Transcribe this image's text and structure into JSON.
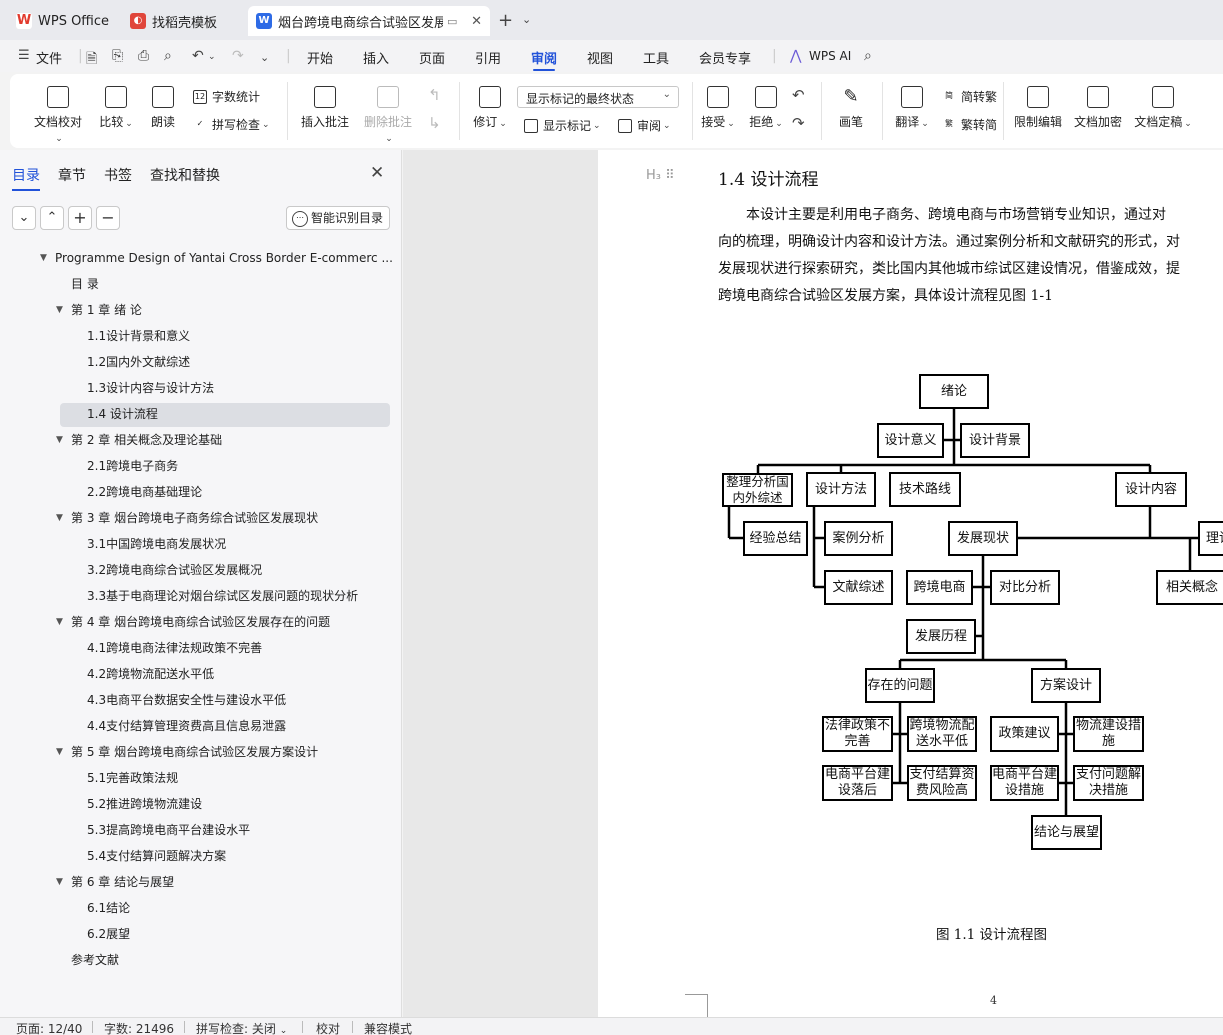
{
  "tabs": [
    {
      "label": "WPS Office"
    },
    {
      "label": "找稻壳模板"
    },
    {
      "label": "烟台跨境电商综合试验区发展方"
    }
  ],
  "menu": {
    "file": "文件",
    "items": [
      "开始",
      "插入",
      "页面",
      "引用",
      "审阅",
      "视图",
      "工具",
      "会员专享"
    ],
    "active": "审阅",
    "ai": "WPS AI"
  },
  "ribbon": {
    "doc_check": "文档校对",
    "compare": "比较",
    "read_aloud": "朗读",
    "word_count": "字数统计",
    "spell_check": "拼写检查",
    "insert_comment": "插入批注",
    "delete_comment": "删除批注",
    "revise": "修订",
    "markup_state": "显示标记的最终状态",
    "show_markup": "显示标记",
    "review": "审阅",
    "accept": "接受",
    "reject": "拒绝",
    "pen": "画笔",
    "translate": "翻译",
    "to_traditional": "简转繁",
    "to_simplified": "繁转简",
    "restrict_edit": "限制编辑",
    "encrypt": "文档加密",
    "finalize": "文档定稿"
  },
  "nav": {
    "tabs": [
      "目录",
      "章节",
      "书签",
      "查找和替换"
    ],
    "active_tab": "目录",
    "smart_toc": "智能识别目录",
    "toc": [
      {
        "text": "Programme Design of Yantai Cross Border E-commerc ...",
        "level": 0,
        "arrow": true
      },
      {
        "text": "目 录",
        "level": 1
      },
      {
        "text": "第 1 章 绪 论",
        "level": 1,
        "arrow": true
      },
      {
        "text": "1.1设计背景和意义",
        "level": 2
      },
      {
        "text": "1.2国内外文献综述",
        "level": 2
      },
      {
        "text": "1.3设计内容与设计方法",
        "level": 2
      },
      {
        "text": "1.4 设计流程",
        "level": 2,
        "selected": true
      },
      {
        "text": "第 2 章 相关概念及理论基础",
        "level": 1,
        "arrow": true
      },
      {
        "text": "2.1跨境电子商务",
        "level": 2
      },
      {
        "text": "2.2跨境电商基础理论",
        "level": 2
      },
      {
        "text": "第 3 章 烟台跨境电子商务综合试验区发展现状",
        "level": 1,
        "arrow": true
      },
      {
        "text": "3.1中国跨境电商发展状况",
        "level": 2
      },
      {
        "text": "3.2跨境电商综合试验区发展概况",
        "level": 2
      },
      {
        "text": "3.3基于电商理论对烟台综试区发展问题的现状分析",
        "level": 2
      },
      {
        "text": "第 4 章 烟台跨境电商综合试验区发展存在的问题",
        "level": 1,
        "arrow": true
      },
      {
        "text": "4.1跨境电商法律法规政策不完善",
        "level": 2
      },
      {
        "text": "4.2跨境物流配送水平低",
        "level": 2
      },
      {
        "text": "4.3电商平台数据安全性与建设水平低",
        "level": 2
      },
      {
        "text": "4.4支付结算管理资费高且信息易泄露",
        "level": 2
      },
      {
        "text": "第 5 章 烟台跨境电商综合试验区发展方案设计",
        "level": 1,
        "arrow": true
      },
      {
        "text": "5.1完善政策法规",
        "level": 2
      },
      {
        "text": "5.2推进跨境物流建设",
        "level": 2
      },
      {
        "text": "5.3提高跨境电商平台建设水平",
        "level": 2
      },
      {
        "text": "5.4支付结算问题解决方案",
        "level": 2
      },
      {
        "text": "第 6 章 结论与展望",
        "level": 1,
        "arrow": true
      },
      {
        "text": "6.1结论",
        "level": 2
      },
      {
        "text": "6.2展望",
        "level": 2
      },
      {
        "text": "参考文献",
        "level": 1
      }
    ]
  },
  "document": {
    "heading": "1.4  设计流程",
    "heading_marker": "H",
    "paragraph_lines": [
      "　　本设计主要是利用电子商务、跨境电商与市场营销专业知识，通过对",
      "向的梳理，明确设计内容和设计方法。通过案例分析和文献研究的形式，对",
      "发展现状进行探索研究，类比国内其他城市综试区建设情况，借鉴成效，提",
      "跨境电商综合试验区发展方案，具体设计流程见图 1-1"
    ],
    "flowchart": {
      "root": "绪论",
      "meaning": "设计意义",
      "background": "设计背景",
      "lit_review": "整理分析国内外综述",
      "method": "设计方法",
      "tech_route": "技术路线",
      "content": "设计内容",
      "experience": "经验总结",
      "case_analysis": "案例分析",
      "literature": "文献综述",
      "status_quo": "发展现状",
      "theory": "理论",
      "cbec": "跨境电商",
      "comparison": "对比分析",
      "concepts": "相关概念",
      "history": "发展历程",
      "problems": "存在的问题",
      "scheme": "方案设计",
      "p_law": "法律政策不完善",
      "p_logistics": "跨境物流配送水平低",
      "s_policy": "政策建议",
      "s_logistics": "物流建设措施",
      "p_platform": "电商平台建设落后",
      "p_payment": "支付结算资费风险高",
      "s_platform": "电商平台建设措施",
      "s_payment": "支付问题解决措施",
      "conclusion": "结论与展望"
    },
    "caption": "图 1.1  设计流程图",
    "page_number": "4"
  },
  "status": {
    "page": "页面: 12/40",
    "words": "字数: 21496",
    "spell": "拼写检查: 关闭",
    "proof": "校对",
    "compat": "兼容模式"
  }
}
